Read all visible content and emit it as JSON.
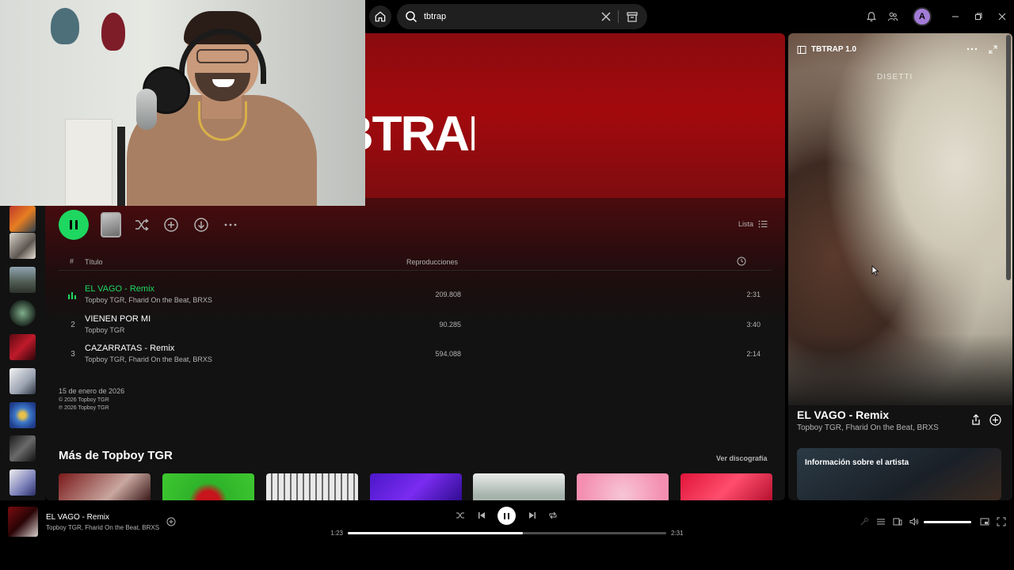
{
  "search": {
    "value": "tbtrap",
    "placeholder": ""
  },
  "profile": {
    "initial": "A"
  },
  "hero": {
    "title": "TBTRAP 1.0"
  },
  "controls": {
    "view_label": "Lista"
  },
  "columns": {
    "num": "#",
    "title": "Título",
    "plays": "Reproducciones"
  },
  "tracks": [
    {
      "num": "1",
      "title": "EL VAGO - Remix",
      "artists": "Topboy TGR, Fharid On the Beat, BRXS",
      "plays": "209.808",
      "duration": "2:31",
      "playing": true
    },
    {
      "num": "2",
      "title": "VIENEN POR MI",
      "artists": "Topboy TGR",
      "plays": "90.285",
      "duration": "3:40",
      "playing": false
    },
    {
      "num": "3",
      "title": "CAZARRATAS - Remix",
      "artists": "Topboy TGR, Fharid On the Beat, BRXS",
      "plays": "594.088",
      "duration": "2:14",
      "playing": false
    }
  ],
  "release": {
    "date": "15 de enero de 2026",
    "copyright_c": "© 2026 Topboy TGR",
    "copyright_p": "℗ 2026 Topboy TGR"
  },
  "more": {
    "title": "Más de Topboy TGR",
    "link": "Ver discografía"
  },
  "right_panel": {
    "title": "TBTRAP 1.0",
    "video_watermark": "DISETTI",
    "now_playing_title": "EL VAGO - Remix",
    "now_playing_artists": "Topboy TGR, Fharid On the Beat, BRXS",
    "artist_card_label": "Información sobre el artista"
  },
  "player": {
    "title": "EL VAGO - Remix",
    "artists": "Topboy TGR, Fharid On the Beat, BRXS",
    "elapsed": "1:23",
    "total": "2:31",
    "progress_fraction": 0.55,
    "volume_fraction": 1.0
  },
  "colors": {
    "accent": "#1ed760",
    "hero_red": "#a3090d",
    "background": "#121212"
  }
}
